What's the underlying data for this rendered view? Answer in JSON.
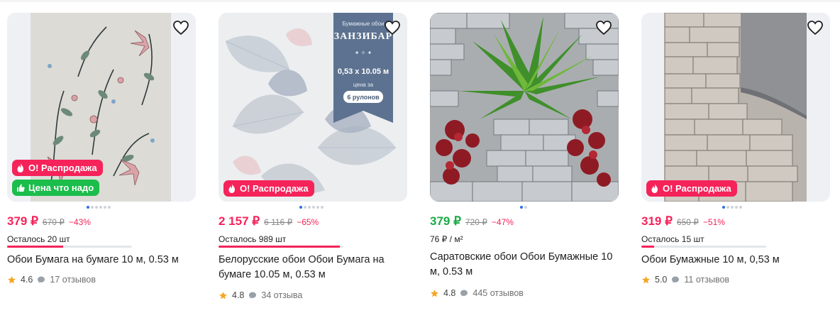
{
  "products": [
    {
      "price": "379 ₽",
      "old_price": "670 ₽",
      "discount": "−43%",
      "stock_text": "Осталось 20 шт",
      "stock_fraction": 0.45,
      "title": "Обои Бумага на бумаге 10 м, 0.53 м",
      "rating": "4.6",
      "reviews": "17 отзывов",
      "badges": [
        "О! Распродажа",
        "Цена что надо"
      ]
    },
    {
      "price": "2 157 ₽",
      "old_price": "6 116 ₽",
      "discount": "−65%",
      "stock_text": "Осталось 989 шт",
      "stock_fraction": 0.97,
      "title": "Белорусские обои Обои Бумага на бумаге 10.05 м, 0.53 м",
      "rating": "4.8",
      "reviews": "34 отзыва",
      "badges": [
        "О! Распродажа"
      ],
      "image_text": {
        "top": "Бумажные обои",
        "brand": "ЗАНЗИБАР",
        "size": "0,53 х 10.05 м",
        "price_for": "цена за",
        "rolls": "6 рулонов"
      }
    },
    {
      "price": "379 ₽",
      "old_price": "720 ₽",
      "discount": "−47%",
      "unit_price": "76 ₽ / м²",
      "title": "Саратовские обои Обои Бумажные 10 м, 0.53 м",
      "rating": "4.8",
      "reviews": "445 отзывов",
      "badges": []
    },
    {
      "price": "319 ₽",
      "old_price": "650 ₽",
      "discount": "−51%",
      "stock_text": "Осталось 15 шт",
      "stock_fraction": 0.1,
      "title": "Обои Бумажные 10 м, 0,53 м",
      "rating": "5.0",
      "reviews": "11 отзывов",
      "badges": [
        "О! Распродажа"
      ]
    }
  ],
  "colors": {
    "accent_pink": "#f5235a",
    "accent_green": "#1aaa46",
    "badge_green": "#1bbd4b",
    "dot_active": "#2c6ee6",
    "star": "#f5a623"
  },
  "icons": [
    "heart-icon",
    "fire-icon",
    "thumbs-up-icon",
    "star-icon",
    "comment-icon"
  ]
}
